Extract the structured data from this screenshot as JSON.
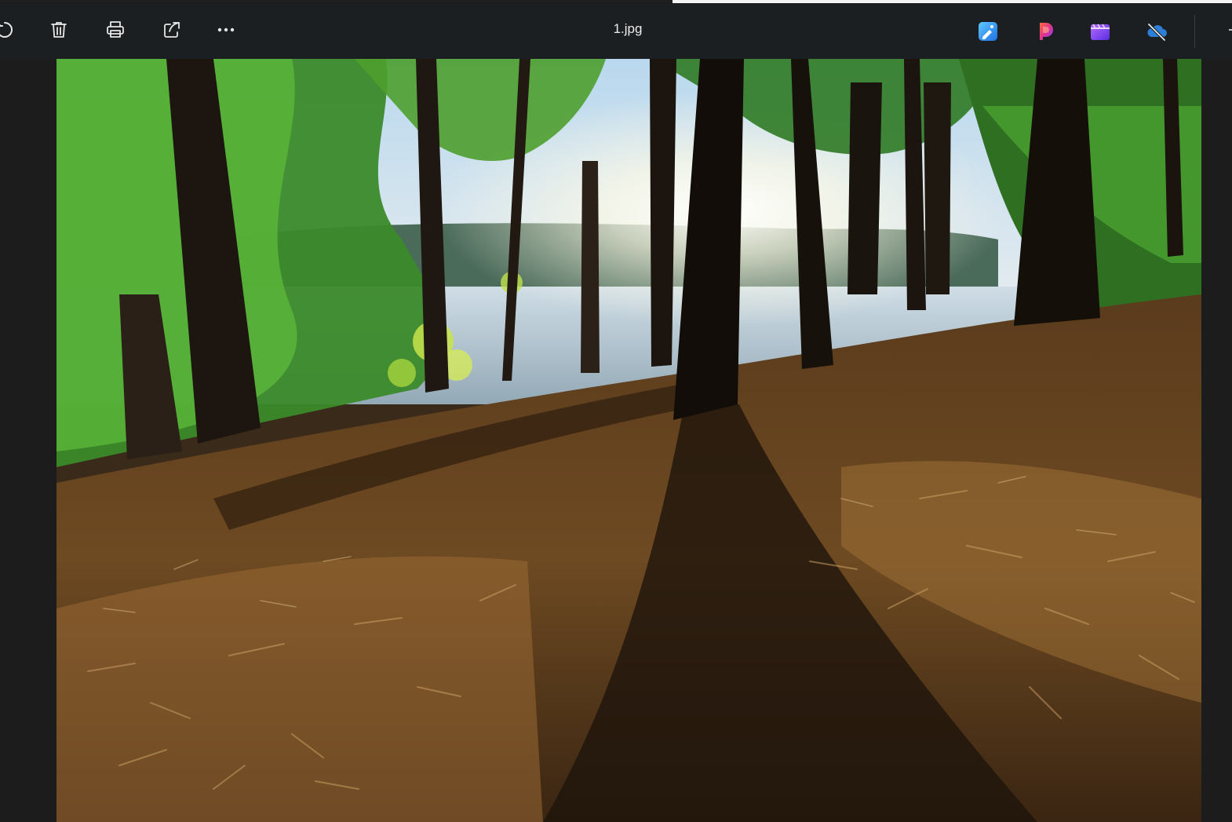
{
  "window": {
    "file_name": "1.jpg"
  },
  "toolbar": {
    "left_icons": [
      "rotate-icon",
      "delete-icon",
      "print-icon",
      "share-icon",
      "more-icon"
    ],
    "right_apps": [
      "photo-editor-app-icon",
      "ai-assistant-app-icon",
      "video-editor-app-icon",
      "cloud-sync-off-icon"
    ]
  },
  "image": {
    "subject": "forest"
  },
  "colors": {
    "toolbar_bg": "#1c1f22",
    "viewer_bg": "#1c1c1c"
  }
}
